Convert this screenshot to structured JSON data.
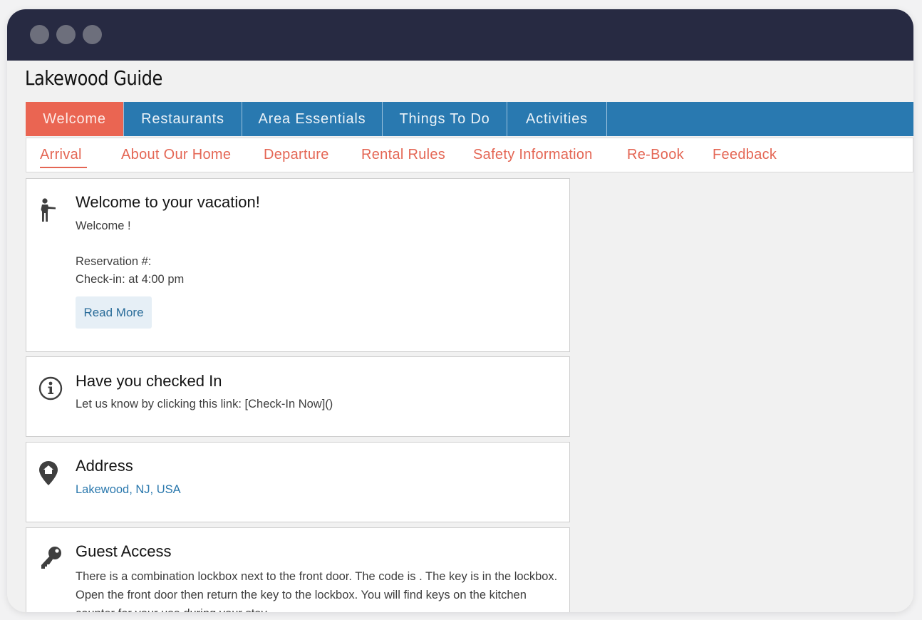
{
  "site": {
    "title": "Lakewood Guide"
  },
  "main_nav": {
    "tabs": [
      {
        "label": "Welcome",
        "active": true
      },
      {
        "label": "Restaurants",
        "active": false
      },
      {
        "label": "Area Essentials",
        "active": false
      },
      {
        "label": "Things To Do",
        "active": false
      },
      {
        "label": "Activities",
        "active": false
      }
    ]
  },
  "sub_nav": {
    "items": [
      {
        "label": "Arrival",
        "active": true
      },
      {
        "label": "About Our Home"
      },
      {
        "label": "Departure"
      },
      {
        "label": "Rental Rules"
      },
      {
        "label": "Safety Information"
      },
      {
        "label": "Re-Book"
      },
      {
        "label": "Feedback"
      }
    ]
  },
  "cards": {
    "welcome": {
      "icon": "person-pointing-icon",
      "title": "Welcome to your vacation!",
      "line1": "Welcome !",
      "reservation": "Reservation #:",
      "checkin": "Check-in: at 4:00 pm",
      "button": "Read More"
    },
    "checkin": {
      "icon": "info-circle-icon",
      "title": "Have you checked In",
      "text": "Let us know by clicking this link: [Check-In Now]()"
    },
    "address": {
      "icon": "map-pin-home-icon",
      "title": "Address",
      "link": "Lakewood, NJ, USA"
    },
    "guest_access": {
      "icon": "key-icon",
      "title": "Guest Access",
      "text": "There is a combination lockbox next to the front door. The code is . The key is in the lockbox. Open the front door then return the key to the lockbox. You will find keys on the kitchen counter for your use during your stay."
    }
  },
  "colors": {
    "titlebar": "#272a42",
    "nav_blue": "#2979b0",
    "accent_coral": "#ea6552",
    "link_blue": "#2a78ad"
  }
}
